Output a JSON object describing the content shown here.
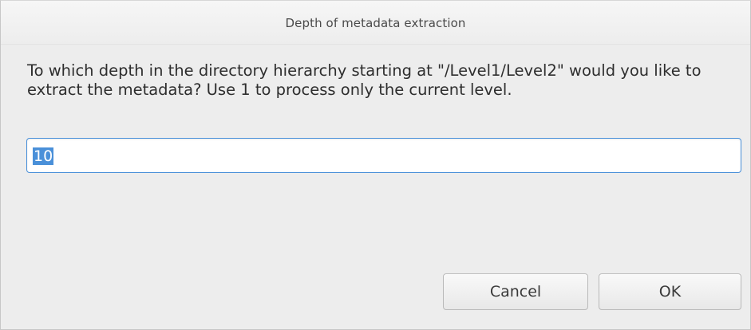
{
  "dialog": {
    "title": "Depth of metadata extraction",
    "message": "To which depth in the directory hierarchy starting at \"/Level1/Level2\" would you like to extract the metadata? Use 1 to process only the current level.",
    "input_value": "10",
    "cancel_label": "Cancel",
    "ok_label": "OK"
  },
  "colors": {
    "background": "#ededed",
    "selection": "#4a90d9",
    "focus_border": "#4a90d9",
    "text": "#2e2e2e"
  }
}
